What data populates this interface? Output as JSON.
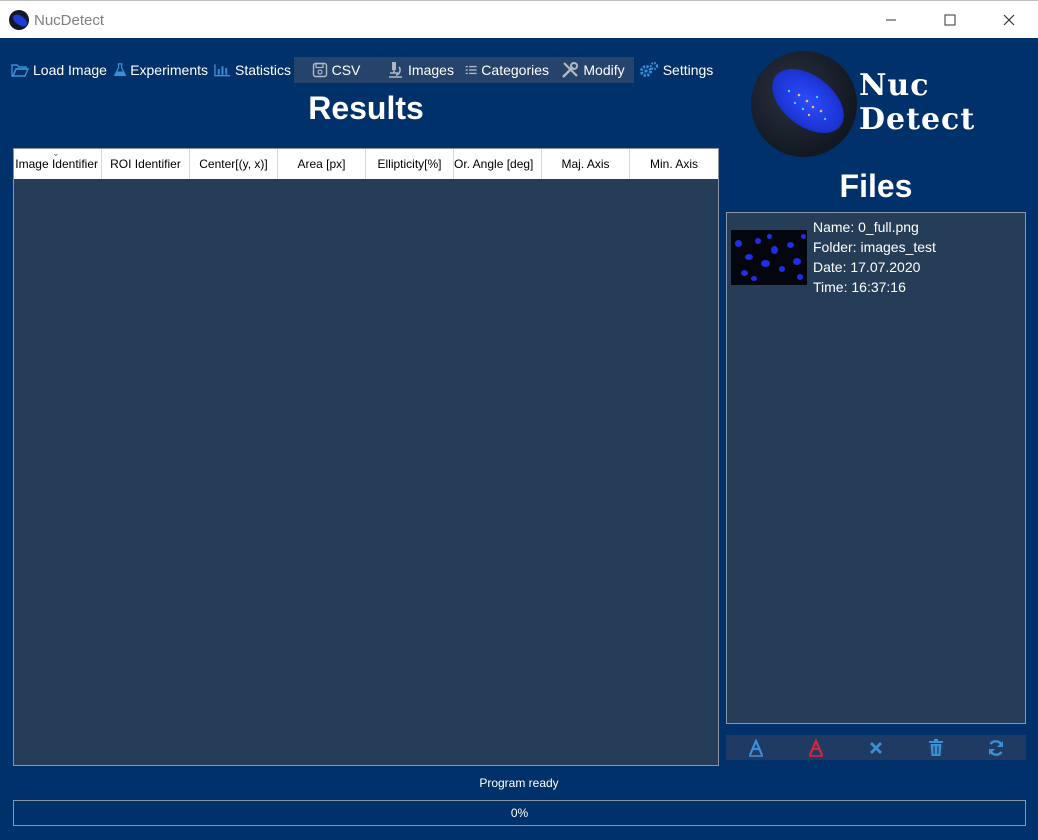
{
  "window": {
    "title": "NucDetect",
    "controls": [
      "minimize-icon",
      "maximize-icon",
      "close-icon"
    ]
  },
  "toolbar": {
    "items": [
      {
        "label": "Load Image",
        "icon": "folder-open-icon"
      },
      {
        "label": "Experiments",
        "icon": "flask-icon"
      },
      {
        "label": "Statistics",
        "icon": "bar-chart-icon"
      },
      {
        "label": "CSV",
        "icon": "save-icon"
      },
      {
        "label": "Images",
        "icon": "microscope-icon"
      },
      {
        "label": "Categories",
        "icon": "list-icon"
      },
      {
        "label": "Modify",
        "icon": "tools-icon"
      },
      {
        "label": "Settings",
        "icon": "gears-icon"
      }
    ]
  },
  "results": {
    "title": "Results",
    "columns": [
      "Image Identifier",
      "ROI Identifier",
      "Center[(y, x)]",
      "Area [px]",
      "Ellipticity[%]",
      "Or. Angle [deg]",
      "Maj. Axis",
      "Min. Axis"
    ],
    "rows": []
  },
  "logo": {
    "line1": "Nuc",
    "line2": "Detect"
  },
  "files": {
    "title": "Files",
    "items": [
      {
        "name": "Name: 0_full.png",
        "folder": "Folder: images_test",
        "date": "Date: 17.07.2020",
        "time": "Time: 16:37:16"
      }
    ],
    "actions": [
      {
        "icon": "analyze-icon",
        "color": "#3a8fd6"
      },
      {
        "icon": "analyze-all-icon",
        "color": "#d6273a"
      },
      {
        "icon": "remove-icon",
        "color": "#3a8fd6"
      },
      {
        "icon": "trash-icon",
        "color": "#3a8fd6"
      },
      {
        "icon": "refresh-icon",
        "color": "#3a8fd6"
      }
    ]
  },
  "status": {
    "message": "Program ready",
    "progress_value": 0,
    "progress_text": "0%"
  },
  "colors": {
    "background": "#01316a",
    "panel": "#263d58",
    "active_tab": "#26446b",
    "icon_accent": "#3a8fd6"
  }
}
